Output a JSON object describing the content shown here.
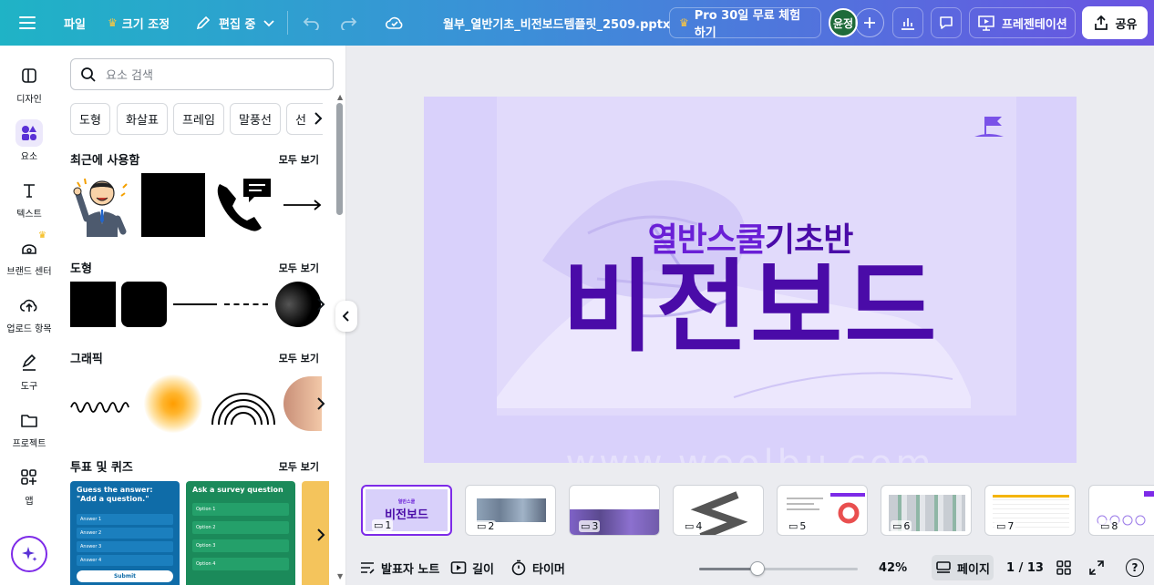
{
  "topbar": {
    "menu_icon": "hamburger-icon",
    "file_label": "파일",
    "resize_label": "크기 조정",
    "edit_label": "편집 중",
    "filename": "월부_열반기초_비전보드템플릿_2509.pptx",
    "pro_label": "Pro 30일 무료 체험하기",
    "avatar_text": "윤정",
    "present_label": "프레젠테이션",
    "share_label": "공유"
  },
  "rail": {
    "items": [
      {
        "label": "디자인",
        "icon": "layout-icon"
      },
      {
        "label": "요소",
        "icon": "shapes-icon"
      },
      {
        "label": "텍스트",
        "icon": "text-icon"
      },
      {
        "label": "브랜드 센터",
        "icon": "brand-icon"
      },
      {
        "label": "업로드 항목",
        "icon": "upload-icon"
      },
      {
        "label": "도구",
        "icon": "pen-tool-icon"
      },
      {
        "label": "프로젝트",
        "icon": "folder-icon"
      },
      {
        "label": "앱",
        "icon": "apps-icon"
      }
    ]
  },
  "panel": {
    "search_placeholder": "요소 검색",
    "chips": [
      "도형",
      "화살표",
      "프레임",
      "말풍선",
      "선"
    ],
    "recent_title": "최근에 사용함",
    "shapes_title": "도형",
    "graphics_title": "그래픽",
    "polls_title": "투표 및 퀴즈",
    "see_all": "모두 보기",
    "quiz": {
      "title": "Guess the answer: \"Add a question.\"",
      "answers": [
        "Answer 1",
        "Answer 2",
        "Answer 3",
        "Answer 4"
      ],
      "submit": "Submit"
    },
    "survey": {
      "title": "Ask a survey question",
      "options": [
        "Option 1",
        "Option 2",
        "Option 3",
        "Option 4"
      ]
    }
  },
  "slide": {
    "subtitle_part1": "열반스쿨",
    "subtitle_part2": "기초반",
    "title": "비전보드",
    "watermark": "www.weolbu.com"
  },
  "thumbnails": [
    "1",
    "2",
    "3",
    "4",
    "5",
    "6",
    "7",
    "8"
  ],
  "bottombar": {
    "notes_label": "발표자 노트",
    "duration_label": "길이",
    "timer_label": "타이머",
    "zoom_percent": 42,
    "zoom_label": "42%",
    "page_label": "페이지",
    "page_counter": "1 / 13"
  },
  "colors": {
    "accent": "#7d2ae8",
    "title_purple": "#4a0ba8",
    "subtitle_purple": "#6a1fd6",
    "slide_bg": "#d8d0fa"
  }
}
